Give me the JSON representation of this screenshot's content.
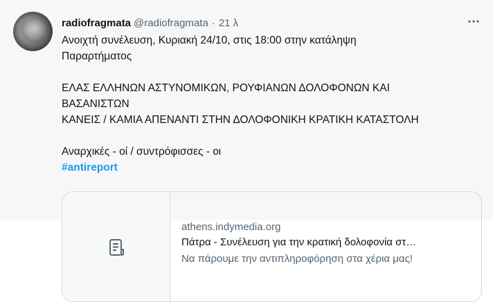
{
  "tweet": {
    "display_name": "radiofragmata",
    "handle": "@radiofragmata",
    "separator": "·",
    "time": "21 λ",
    "more_icon": "more-horizontal-icon",
    "lines": [
      "Ανοιχτή συνέλευση, Κυριακή 24/10, στις 18:00 στην κατάληψη",
      "Παραρτήματος",
      "ΕΛΑΣ ΕΛΛΗΝΩΝ ΑΣΤΥΝΟΜΙΚΩΝ, ΡΟΥΦΙΑΝΩΝ ΔΟΛΟΦΟΝΩΝ ΚΑΙ",
      "ΒΑΣΑΝΙΣΤΩΝ",
      "ΚΑΝΕΙΣ / ΚΑΜΙΑ ΑΠΕΝΑΝΤΙ ΣΤΗΝ ΔΟΛΟΦΟΝΙΚΗ ΚΡΑΤΙΚΗ ΚΑΤΑΣΤΟΛΗ",
      "Αναρχικές - οί / συντρόφισσες - οι"
    ],
    "hashtag": "#antireport"
  },
  "card": {
    "icon": "document-icon",
    "domain": "athens.indymedia.org",
    "title": "Πάτρα - Συνέλευση για την κρατική δολοφονία στ…",
    "description": "Να πάρουμε την αντιπληροφόρηση στα χέρια μας!"
  },
  "colors": {
    "tweet_background": "#f7f7f7",
    "link": "#1d9bf0",
    "secondary_text": "#536471",
    "primary_text": "#0f1419",
    "card_border": "#cfd9de"
  }
}
